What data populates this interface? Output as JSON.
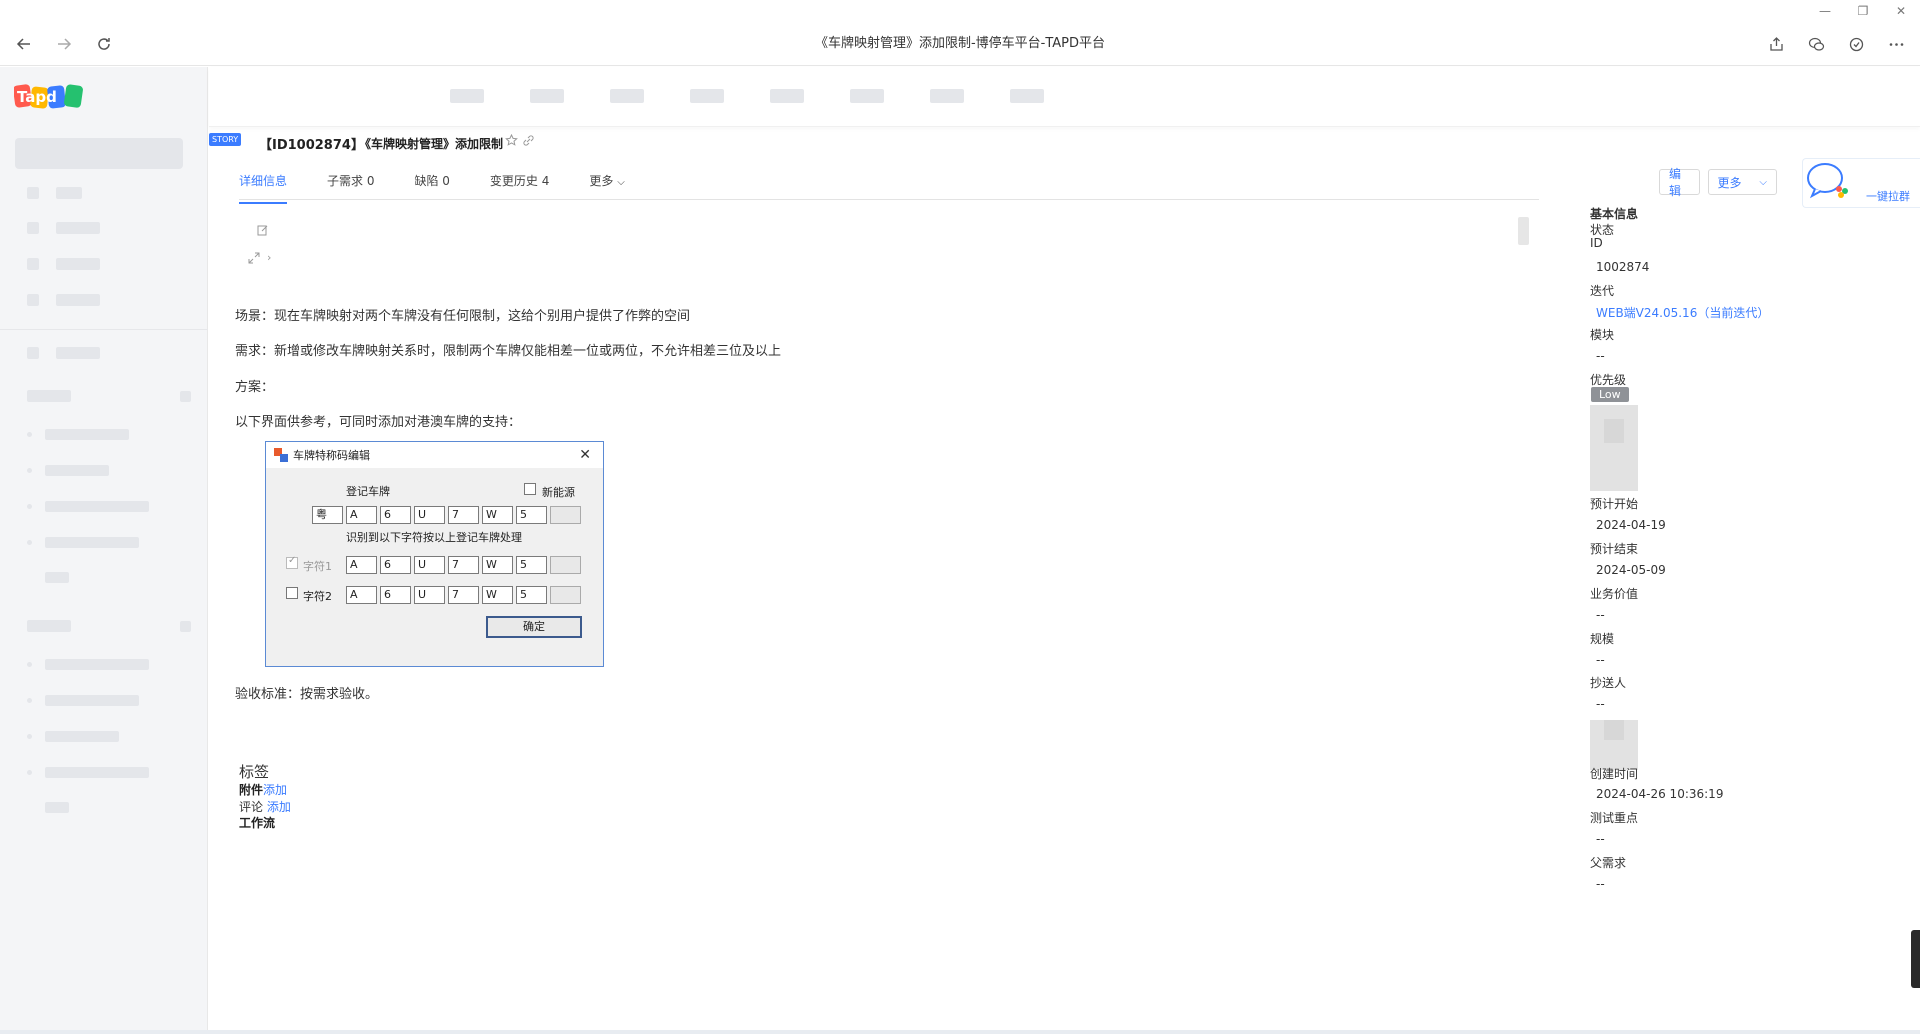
{
  "browser": {
    "title": "《车牌映射管理》添加限制-博停车平台-TAPD平台",
    "window_controls": [
      "—",
      "❐",
      "✕"
    ]
  },
  "logo_text": "Tapd",
  "story": {
    "badge": "STORY",
    "id_label": "【ID1002874】",
    "title": "《车牌映射管理》添加限制"
  },
  "tabs": [
    {
      "label": "详细信息",
      "active": true
    },
    {
      "label": "子需求 0",
      "active": false
    },
    {
      "label": "缺陷 0",
      "active": false
    },
    {
      "label": "变更历史 4",
      "active": false
    },
    {
      "label": "更多",
      "active": false
    }
  ],
  "toolbar": {
    "edit_label": "编辑",
    "more_label": "更多"
  },
  "wechat_label": "一键拉群",
  "content": {
    "p1": "场景：现在车牌映射对两个车牌没有任何限制，这给个别用户提供了作弊的空间",
    "p2": "需求：新增或修改车牌映射关系时，限制两个车牌仅能相差一位或两位，不允许相差三位及以上",
    "p3": "方案：",
    "p4": "以下界面供参考，可同时添加对港澳车牌的支持：",
    "p5": "验收标准：按需求验收。"
  },
  "dialog": {
    "title": "车牌特称码编辑",
    "register_label": "登记车牌",
    "new_energy_label": "新能源",
    "hint": "识别到以下字符按以上登记车牌处理",
    "char1_label": "字符1",
    "char2_label": "字符2",
    "ok_label": "确定",
    "plate_row": [
      "粤",
      "A",
      "6",
      "U",
      "7",
      "W",
      "5",
      ""
    ],
    "char1_row": [
      "A",
      "6",
      "U",
      "7",
      "W",
      "5",
      ""
    ],
    "char2_row": [
      "A",
      "6",
      "U",
      "7",
      "W",
      "5",
      ""
    ]
  },
  "lower": {
    "tags_label": "标签",
    "attach_label": "附件",
    "attach_link": "添加",
    "comment_label": "评论",
    "comment_link": "添加",
    "workflow_label": "工作流"
  },
  "right_panel": {
    "basic_info": "基本信息",
    "status_label": "状态",
    "id_label": "ID",
    "id_value": "1002874",
    "iteration_label": "迭代",
    "iteration_value": "WEB端V24.05.16（当前迭代）",
    "module_label": "模块",
    "module_value": "--",
    "priority_label": "优先级",
    "priority_value": "Low",
    "start_label": "预计开始",
    "start_value": "2024-04-19",
    "end_label": "预计结束",
    "end_value": "2024-05-09",
    "biz_label": "业务价值",
    "biz_value": "--",
    "scale_label": "规模",
    "scale_value": "--",
    "cc_label": "抄送人",
    "cc_value": "--",
    "created_label": "创建时间",
    "created_value": "2024-04-26 10:36:19",
    "test_label": "测试重点",
    "test_value": "--",
    "parent_label": "父需求",
    "parent_value": "--"
  },
  "colors": {
    "accent": "#3b7cff",
    "badge_low": "#8f9297"
  }
}
